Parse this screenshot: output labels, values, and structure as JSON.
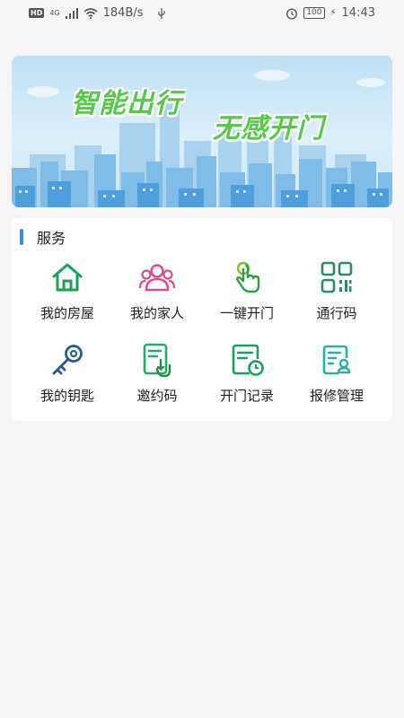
{
  "status_bar": {
    "network_badge": "HD",
    "network_type": "4G",
    "speed": "184B/s",
    "battery": "100",
    "time": "14:43"
  },
  "banner": {
    "line1": "智能出行",
    "line2": "无感开门"
  },
  "services": {
    "title": "服务",
    "items": [
      {
        "label": "我的房屋",
        "icon": "house-icon",
        "color": "#1aa05a"
      },
      {
        "label": "我的家人",
        "icon": "family-icon",
        "color": "#d84f8f"
      },
      {
        "label": "一键开门",
        "icon": "touch-icon",
        "color": "#7bbf2f"
      },
      {
        "label": "通行码",
        "icon": "qr-code-icon",
        "color": "#2e8a6a"
      },
      {
        "label": "我的钥匙",
        "icon": "key-icon",
        "color": "#2a5a8a"
      },
      {
        "label": "邀约码",
        "icon": "invite-code-icon",
        "color": "#2aa86a"
      },
      {
        "label": "开门记录",
        "icon": "door-record-icon",
        "color": "#1aa05a"
      },
      {
        "label": "报修管理",
        "icon": "repair-icon",
        "color": "#2ab0a0"
      }
    ]
  }
}
